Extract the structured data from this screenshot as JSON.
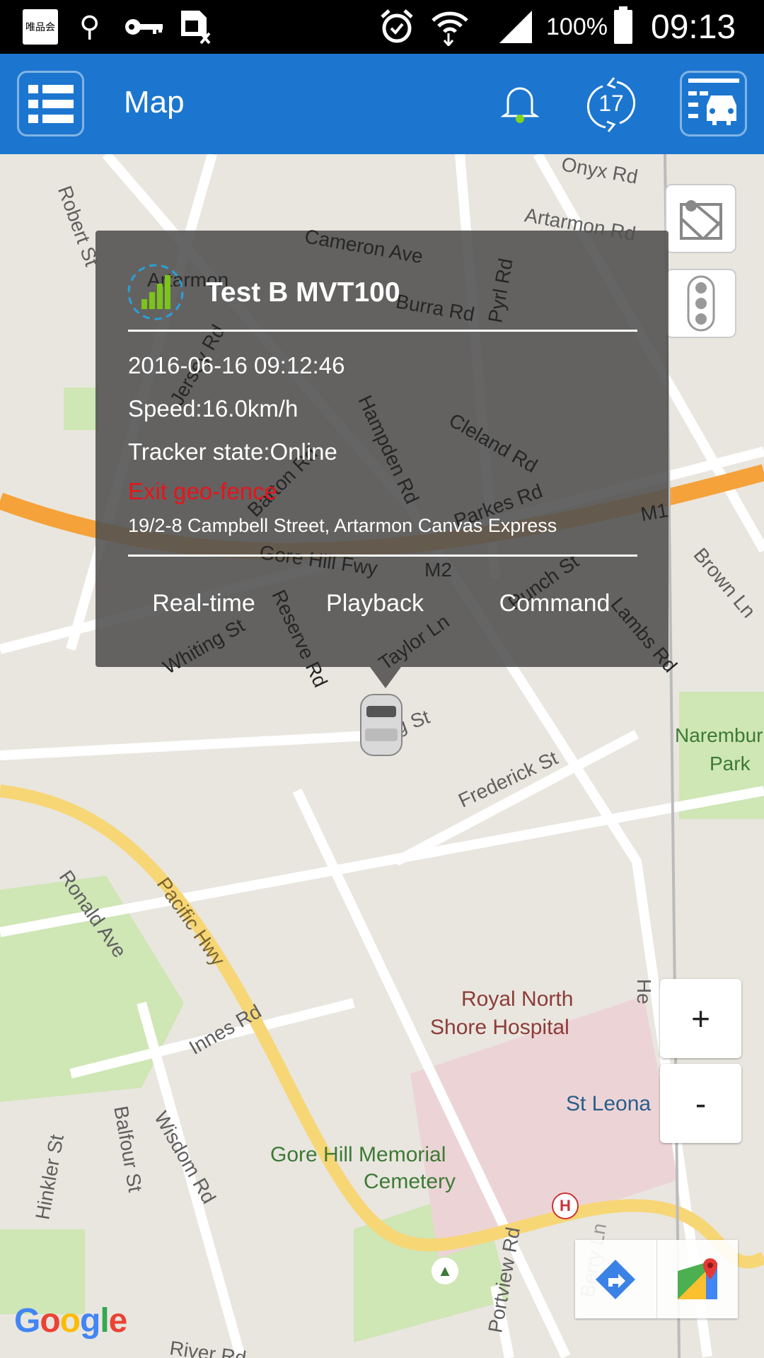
{
  "status_bar": {
    "app_badge": "唯品会",
    "icons": [
      "vip-app-icon",
      "usb-icon",
      "vpn-key-icon",
      "no-sim-icon",
      "alarm-icon",
      "wifi-icon",
      "signal-icon",
      "battery-icon"
    ],
    "battery": "100%",
    "time": "09:13"
  },
  "header": {
    "title": "Map",
    "refresh_count": "17",
    "colors": {
      "bar": "#1c76cf",
      "bell_dot": "#7ed321"
    }
  },
  "popup": {
    "device_name": "Test B MVT100",
    "datetime": "2016-06-16 09:12:46",
    "speed": "Speed:16.0km/h",
    "tracker_state": "Tracker state:Online",
    "alert": "Exit geo-fence",
    "address": "19/2-8 Campbell Street, Artarmon Canvas Express",
    "actions": [
      "Real-time",
      "Playback",
      "Command"
    ],
    "alert_color": "#e8141a"
  },
  "map": {
    "labels": [
      "Onyx Rd",
      "Artarmon Rd",
      "Robert St",
      "Cameron Ave",
      "Pyrl Rd",
      "Burra Rd",
      "Artarmon",
      "Jersey Rd",
      "Hampden Rd",
      "Cleland Rd",
      "Barton Rd",
      "Parkes Rd",
      "Gore Hill Fwy",
      "M2",
      "M1",
      "Brown Ln",
      "Punch St",
      "Lambs Rd",
      "Whiting St",
      "Reserve Rd",
      "Taylor Ln",
      "Cleg St",
      "Frederick St",
      "Naremburn",
      "Park",
      "Ronald Ave",
      "Pacific Hwy",
      "Royal North",
      "Shore Hospital",
      "St Leona",
      "Innes Rd",
      "Wisdom Rd",
      "Balfour St",
      "Hinkler St",
      "Gore Hill Memorial",
      "Cemetery",
      "Portview Rd",
      "Berry Ln",
      "River Rd",
      "He"
    ],
    "zoom_in": "+",
    "zoom_out": "-",
    "google_logo": "Google"
  }
}
